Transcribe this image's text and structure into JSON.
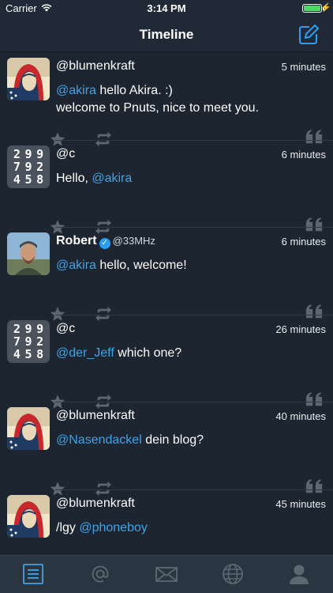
{
  "status_bar": {
    "carrier": "Carrier",
    "time": "3:14 PM",
    "battery_level": 1.0
  },
  "nav": {
    "title": "Timeline",
    "compose_icon": "compose-icon"
  },
  "posts": [
    {
      "handle": "@blumenkraft",
      "time": "5 minutes",
      "avatar": "illustrated-portrait",
      "text": [
        {
          "mention": "@akira",
          "rest": " hello Akira. :)"
        },
        {
          "mention": "",
          "rest": "welcome to Pnuts, nice to meet you."
        }
      ]
    },
    {
      "handle": "@c",
      "time": "6 minutes",
      "avatar_digits": [
        "2",
        "9",
        "9",
        "7",
        "9",
        "2",
        "4",
        "5",
        "8"
      ],
      "text_prefix": "Hello, ",
      "mention": "@akira"
    },
    {
      "name": "Robert",
      "handle": "@33MHz",
      "time": "6 minutes",
      "avatar": "photo-portrait",
      "mention": "@akira",
      "rest": " hello, welcome!"
    },
    {
      "handle": "@c",
      "time": "26 minutes",
      "avatar_digits": [
        "2",
        "9",
        "9",
        "7",
        "9",
        "2",
        "4",
        "5",
        "8"
      ],
      "mention": "@der_Jeff",
      "rest": " which one?"
    },
    {
      "handle": "@blumenkraft",
      "time": "40 minutes",
      "avatar": "illustrated-portrait",
      "mention": "@Nasendackel",
      "rest": " dein blog?"
    },
    {
      "handle": "@blumenkraft",
      "time": "45 minutes",
      "avatar": "illustrated-portrait",
      "text_prefix": "/lgy ",
      "mention": "@phoneboy"
    }
  ],
  "tabs": [
    {
      "icon": "timeline-list-icon",
      "active": true
    },
    {
      "icon": "mentions-at-icon",
      "active": false
    },
    {
      "icon": "messages-envelope-icon",
      "active": false
    },
    {
      "icon": "global-globe-icon",
      "active": false
    },
    {
      "icon": "profile-person-icon",
      "active": false
    }
  ],
  "colors": {
    "background": "#1c2530",
    "bar": "#202a36",
    "tabbar": "#2a3542",
    "accent": "#3fa3e8",
    "icon_muted": "#5d6772"
  }
}
